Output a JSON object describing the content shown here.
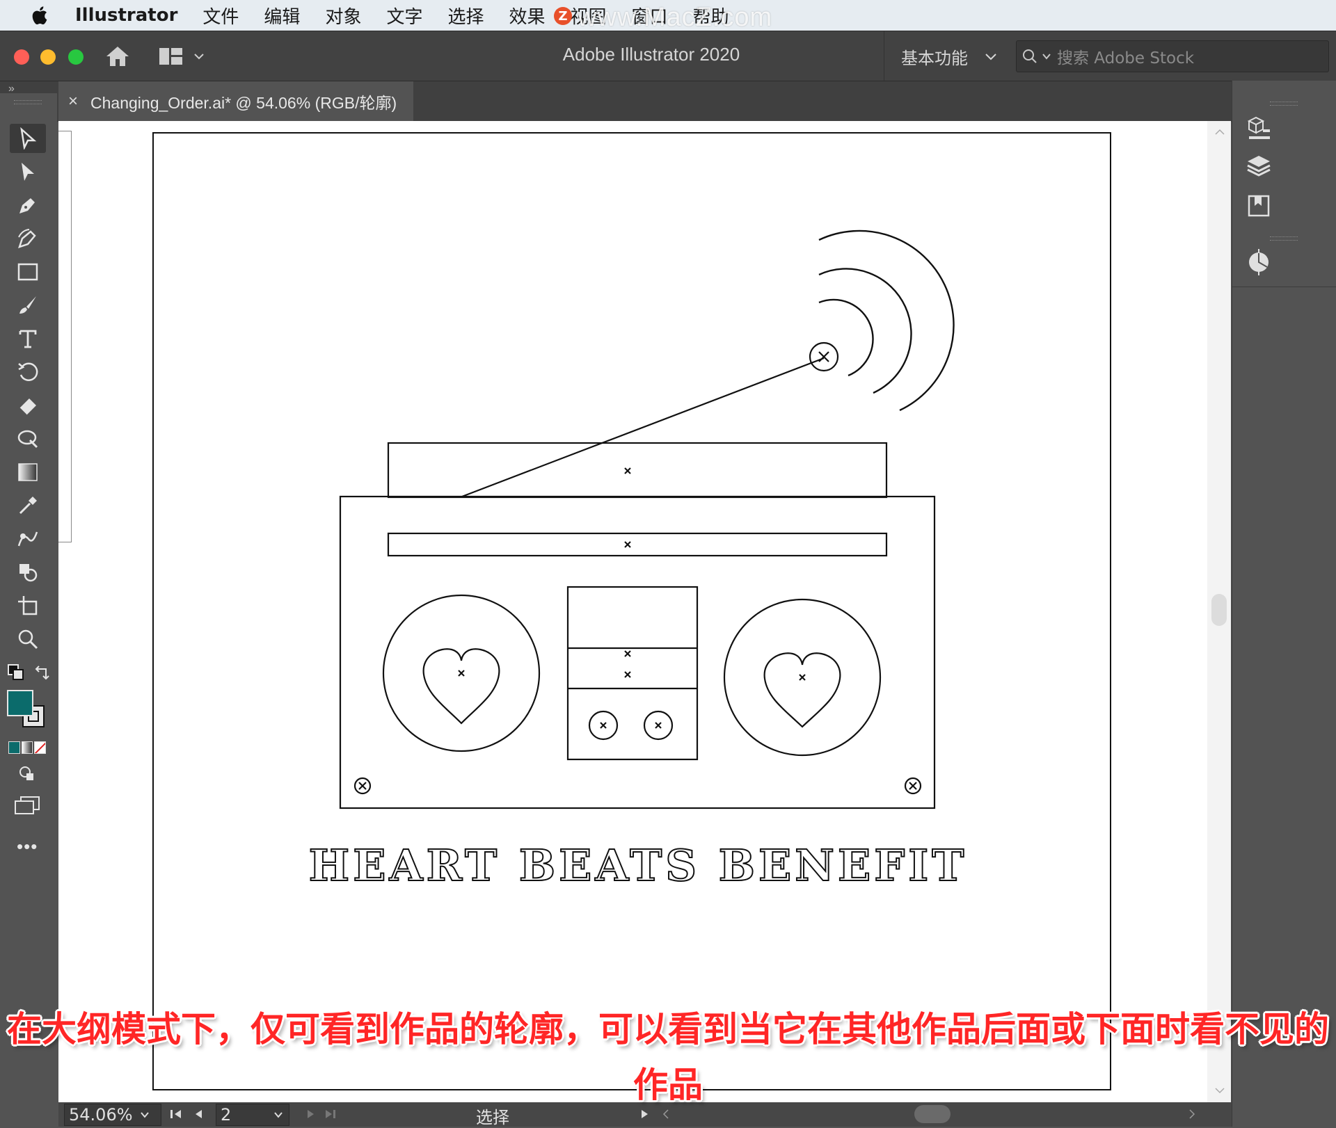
{
  "menubar": {
    "app_name": "Illustrator",
    "items": [
      "文件",
      "编辑",
      "对象",
      "文字",
      "选择",
      "效果",
      "视图",
      "窗口",
      "帮助"
    ],
    "watermark": "www.MacZ.com",
    "watermark_badge": "Z"
  },
  "titlebar": {
    "title": "Adobe Illustrator 2020",
    "workspace": "基本功能",
    "search_placeholder": "搜索 Adobe Stock"
  },
  "document": {
    "tab_title": "Changing_Order.ai* @ 54.06% (RGB/轮廓)"
  },
  "artwork": {
    "headline": "HEART BEATS BENEFIT"
  },
  "statusbar": {
    "zoom": "54.06%",
    "artboard": "2",
    "tool_label": "选择"
  },
  "caption": {
    "line1": "在大纲模式下，仅可看到作品的轮廓，可以看到当它在其他作品后面或下面时看不见的",
    "line2": "作品"
  },
  "colors": {
    "fill_swatch": "#0b6b6b",
    "traffic_close": "#ff5f57",
    "traffic_minimize": "#febc2e",
    "traffic_zoom": "#28c840",
    "caption_text": "#ff2626"
  },
  "icons": [
    "apple-icon",
    "home-icon",
    "workspace-layout-icon",
    "chevron-down-icon",
    "search-icon",
    "close-tab-icon",
    "selection-tool-icon",
    "direct-selection-tool-icon",
    "pen-tool-icon",
    "curvature-tool-icon",
    "rectangle-tool-icon",
    "paintbrush-tool-icon",
    "type-tool-icon",
    "rotate-tool-icon",
    "eraser-tool-icon",
    "puppet-warp-tool-icon",
    "gradient-tool-icon",
    "eyedropper-tool-icon",
    "blend-tool-icon",
    "shape-builder-tool-icon",
    "artboard-tool-icon",
    "zoom-tool-icon",
    "properties-panel-icon",
    "layers-panel-icon",
    "libraries-panel-icon",
    "color-guide-icon"
  ]
}
